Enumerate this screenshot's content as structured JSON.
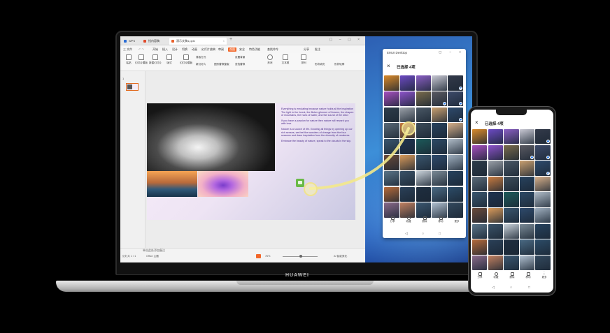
{
  "laptop": {
    "brand": "HUAWEI",
    "wps": {
      "tabs": [
        {
          "label": "WPS",
          "color": "#2b6ed6"
        },
        {
          "label": "找内容稿",
          "color": "#e14a2b"
        },
        {
          "label": "演示文稿1.pptx",
          "color": "#e8612b"
        }
      ],
      "menu": [
        "三 文件",
        "开始",
        "插入",
        "设计",
        "切换",
        "动画",
        "幻灯片放映",
        "审阅",
        "视图",
        "安全",
        "特色功能",
        "查找命令"
      ],
      "menu_active": "开始",
      "toolbar_right": [
        "分享",
        "批注"
      ],
      "ribbon": [
        {
          "label": "粘贴"
        },
        {
          "label": "幻灯片模板"
        },
        {
          "label": "新建幻灯片"
        },
        {
          "label": "版式"
        },
        {
          "label": "幻灯片模板"
        },
        {
          "label": "重置"
        },
        {
          "label": "形状"
        },
        {
          "label": "文本框"
        },
        {
          "label": "排列"
        }
      ],
      "ribbon_small": [
        "排版方式",
        "新幻灯片",
        "图形替换整版",
        "设置背景",
        "查找替换",
        "形状填充",
        "形状轮廓"
      ],
      "slide_number": "1",
      "slide_text": [
        "Everything is emulating because nature holds all the inspiration The light in the forest, the flicker glimmer of flowers, the shapes of mountains, the hues of water, and the sound of the wind",
        "If you have a passion for nature then nature will reward you with love.",
        "Nature is a source of life. Growing all things by opening up our rich senses, we feel the wonders of change from the four seasons and draw inspiration from the diversity of creatures.",
        "Embrace the beauty of nature, speak to the clouds in the sky."
      ],
      "notes_placeholder": "单击此处添加备注",
      "status": {
        "slide_counter": "幻灯片 1 / 1",
        "theme": "Office 主题",
        "zoom": "76%",
        "ai": "AI 智能美化"
      }
    },
    "gallery": {
      "titlebar": "EMUI Desktop",
      "close": "×",
      "title": "已选择 4项",
      "actions": [
        "分享",
        "收藏",
        "删除",
        "移动",
        "更多"
      ],
      "nav": [
        "◁",
        "○",
        "□"
      ]
    }
  },
  "phone": {
    "gallery": {
      "title": "已选择 4项",
      "close": "×",
      "actions": [
        "分享",
        "收藏",
        "删除",
        "移动",
        "更多"
      ],
      "nav": [
        "◁",
        "○",
        "□"
      ]
    }
  },
  "photo_grid": {
    "rows": 9,
    "cols": 5,
    "colors": [
      [
        "#d98a2a",
        "#6c4ac2",
        "#8a5fc4",
        "#c9c9d4",
        "#333a4a"
      ],
      [
        "#a64fbf",
        "#8c52c9",
        "#7a6b4c",
        "#5a5a62",
        "#3c4a6a"
      ],
      [
        "#2d3c4a",
        "#9aa0a8",
        "#4a5866",
        "#c9a070",
        "#2e4a6c"
      ],
      [
        "#5a6a78",
        "#c77b40",
        "#3c4c5a",
        "#27425e",
        "#d7b08a"
      ],
      [
        "#3a566e",
        "#1e3350",
        "#1c5a5a",
        "#2d4a66",
        "#b0bcc8"
      ],
      [
        "#6a4a3a",
        "#d89a5a",
        "#3a566e",
        "#2e4a6c",
        "#a0b0c0"
      ],
      [
        "#5a7488",
        "#3a5268",
        "#c9d2da",
        "#7a8a96",
        "#26425e"
      ],
      [
        "#b46a3a",
        "#2a4058",
        "#1e2e40",
        "#4a6a84",
        "#2c4c68"
      ],
      [
        "#8a6a8a",
        "#c08060",
        "#3a5670",
        "#b0c0d0",
        "#33495e"
      ]
    ],
    "selected": [
      [
        0,
        4
      ],
      [
        1,
        3
      ],
      [
        1,
        4
      ],
      [
        2,
        4
      ]
    ]
  }
}
